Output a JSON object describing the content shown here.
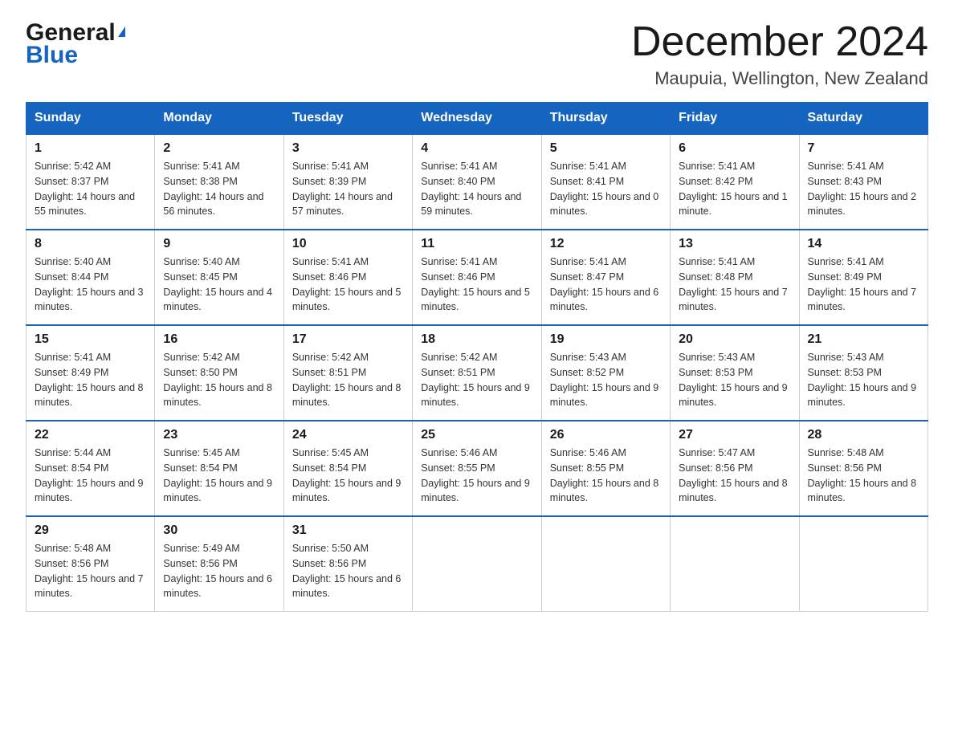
{
  "logo": {
    "line1_general": "General",
    "line1_icon": "▶",
    "line2_blue": "Blue"
  },
  "header": {
    "title": "December 2024",
    "subtitle": "Maupuia, Wellington, New Zealand"
  },
  "weekdays": [
    "Sunday",
    "Monday",
    "Tuesday",
    "Wednesday",
    "Thursday",
    "Friday",
    "Saturday"
  ],
  "weeks": [
    [
      {
        "day": "1",
        "sunrise": "5:42 AM",
        "sunset": "8:37 PM",
        "daylight": "14 hours and 55 minutes."
      },
      {
        "day": "2",
        "sunrise": "5:41 AM",
        "sunset": "8:38 PM",
        "daylight": "14 hours and 56 minutes."
      },
      {
        "day": "3",
        "sunrise": "5:41 AM",
        "sunset": "8:39 PM",
        "daylight": "14 hours and 57 minutes."
      },
      {
        "day": "4",
        "sunrise": "5:41 AM",
        "sunset": "8:40 PM",
        "daylight": "14 hours and 59 minutes."
      },
      {
        "day": "5",
        "sunrise": "5:41 AM",
        "sunset": "8:41 PM",
        "daylight": "15 hours and 0 minutes."
      },
      {
        "day": "6",
        "sunrise": "5:41 AM",
        "sunset": "8:42 PM",
        "daylight": "15 hours and 1 minute."
      },
      {
        "day": "7",
        "sunrise": "5:41 AM",
        "sunset": "8:43 PM",
        "daylight": "15 hours and 2 minutes."
      }
    ],
    [
      {
        "day": "8",
        "sunrise": "5:40 AM",
        "sunset": "8:44 PM",
        "daylight": "15 hours and 3 minutes."
      },
      {
        "day": "9",
        "sunrise": "5:40 AM",
        "sunset": "8:45 PM",
        "daylight": "15 hours and 4 minutes."
      },
      {
        "day": "10",
        "sunrise": "5:41 AM",
        "sunset": "8:46 PM",
        "daylight": "15 hours and 5 minutes."
      },
      {
        "day": "11",
        "sunrise": "5:41 AM",
        "sunset": "8:46 PM",
        "daylight": "15 hours and 5 minutes."
      },
      {
        "day": "12",
        "sunrise": "5:41 AM",
        "sunset": "8:47 PM",
        "daylight": "15 hours and 6 minutes."
      },
      {
        "day": "13",
        "sunrise": "5:41 AM",
        "sunset": "8:48 PM",
        "daylight": "15 hours and 7 minutes."
      },
      {
        "day": "14",
        "sunrise": "5:41 AM",
        "sunset": "8:49 PM",
        "daylight": "15 hours and 7 minutes."
      }
    ],
    [
      {
        "day": "15",
        "sunrise": "5:41 AM",
        "sunset": "8:49 PM",
        "daylight": "15 hours and 8 minutes."
      },
      {
        "day": "16",
        "sunrise": "5:42 AM",
        "sunset": "8:50 PM",
        "daylight": "15 hours and 8 minutes."
      },
      {
        "day": "17",
        "sunrise": "5:42 AM",
        "sunset": "8:51 PM",
        "daylight": "15 hours and 8 minutes."
      },
      {
        "day": "18",
        "sunrise": "5:42 AM",
        "sunset": "8:51 PM",
        "daylight": "15 hours and 9 minutes."
      },
      {
        "day": "19",
        "sunrise": "5:43 AM",
        "sunset": "8:52 PM",
        "daylight": "15 hours and 9 minutes."
      },
      {
        "day": "20",
        "sunrise": "5:43 AM",
        "sunset": "8:53 PM",
        "daylight": "15 hours and 9 minutes."
      },
      {
        "day": "21",
        "sunrise": "5:43 AM",
        "sunset": "8:53 PM",
        "daylight": "15 hours and 9 minutes."
      }
    ],
    [
      {
        "day": "22",
        "sunrise": "5:44 AM",
        "sunset": "8:54 PM",
        "daylight": "15 hours and 9 minutes."
      },
      {
        "day": "23",
        "sunrise": "5:45 AM",
        "sunset": "8:54 PM",
        "daylight": "15 hours and 9 minutes."
      },
      {
        "day": "24",
        "sunrise": "5:45 AM",
        "sunset": "8:54 PM",
        "daylight": "15 hours and 9 minutes."
      },
      {
        "day": "25",
        "sunrise": "5:46 AM",
        "sunset": "8:55 PM",
        "daylight": "15 hours and 9 minutes."
      },
      {
        "day": "26",
        "sunrise": "5:46 AM",
        "sunset": "8:55 PM",
        "daylight": "15 hours and 8 minutes."
      },
      {
        "day": "27",
        "sunrise": "5:47 AM",
        "sunset": "8:56 PM",
        "daylight": "15 hours and 8 minutes."
      },
      {
        "day": "28",
        "sunrise": "5:48 AM",
        "sunset": "8:56 PM",
        "daylight": "15 hours and 8 minutes."
      }
    ],
    [
      {
        "day": "29",
        "sunrise": "5:48 AM",
        "sunset": "8:56 PM",
        "daylight": "15 hours and 7 minutes."
      },
      {
        "day": "30",
        "sunrise": "5:49 AM",
        "sunset": "8:56 PM",
        "daylight": "15 hours and 6 minutes."
      },
      {
        "day": "31",
        "sunrise": "5:50 AM",
        "sunset": "8:56 PM",
        "daylight": "15 hours and 6 minutes."
      },
      null,
      null,
      null,
      null
    ]
  ]
}
